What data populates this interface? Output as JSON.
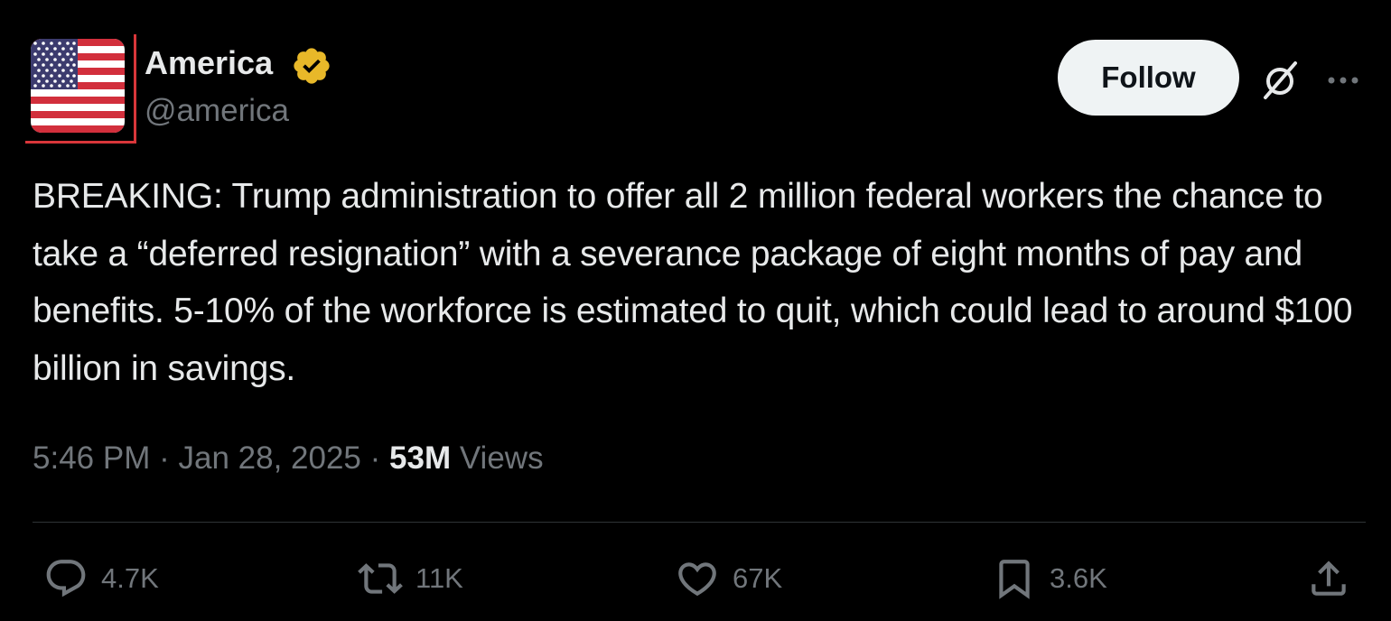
{
  "author": {
    "display_name": "America",
    "handle": "@america",
    "verified_color": "#e8b829",
    "avatar": "us-flag"
  },
  "follow_label": "Follow",
  "tweet": {
    "text": "BREAKING: Trump administration to offer all 2 million federal workers the chance to take a “deferred resignation” with a severance package of eight months of pay and benefits. 5-10% of the workforce is estimated to quit, which could lead to around $100 billion in savings.",
    "time": "5:46 PM",
    "separator": "·",
    "date": "Jan 28, 2025",
    "views_count": "53M",
    "views_label": "Views"
  },
  "actions": {
    "replies": "4.7K",
    "retweets": "11K",
    "likes": "67K",
    "bookmarks": "3.6K"
  },
  "icons": {
    "reply": "reply-icon",
    "retweet": "retweet-icon",
    "like": "heart-icon",
    "bookmark": "bookmark-icon",
    "share": "share-icon",
    "grok": "grok-icon",
    "more": "more-icon"
  },
  "colors": {
    "background": "#000000",
    "text_primary": "#e7e9ea",
    "text_secondary": "#71767b",
    "follow_bg": "#eff3f4",
    "avatar_border": "#d9363a"
  }
}
